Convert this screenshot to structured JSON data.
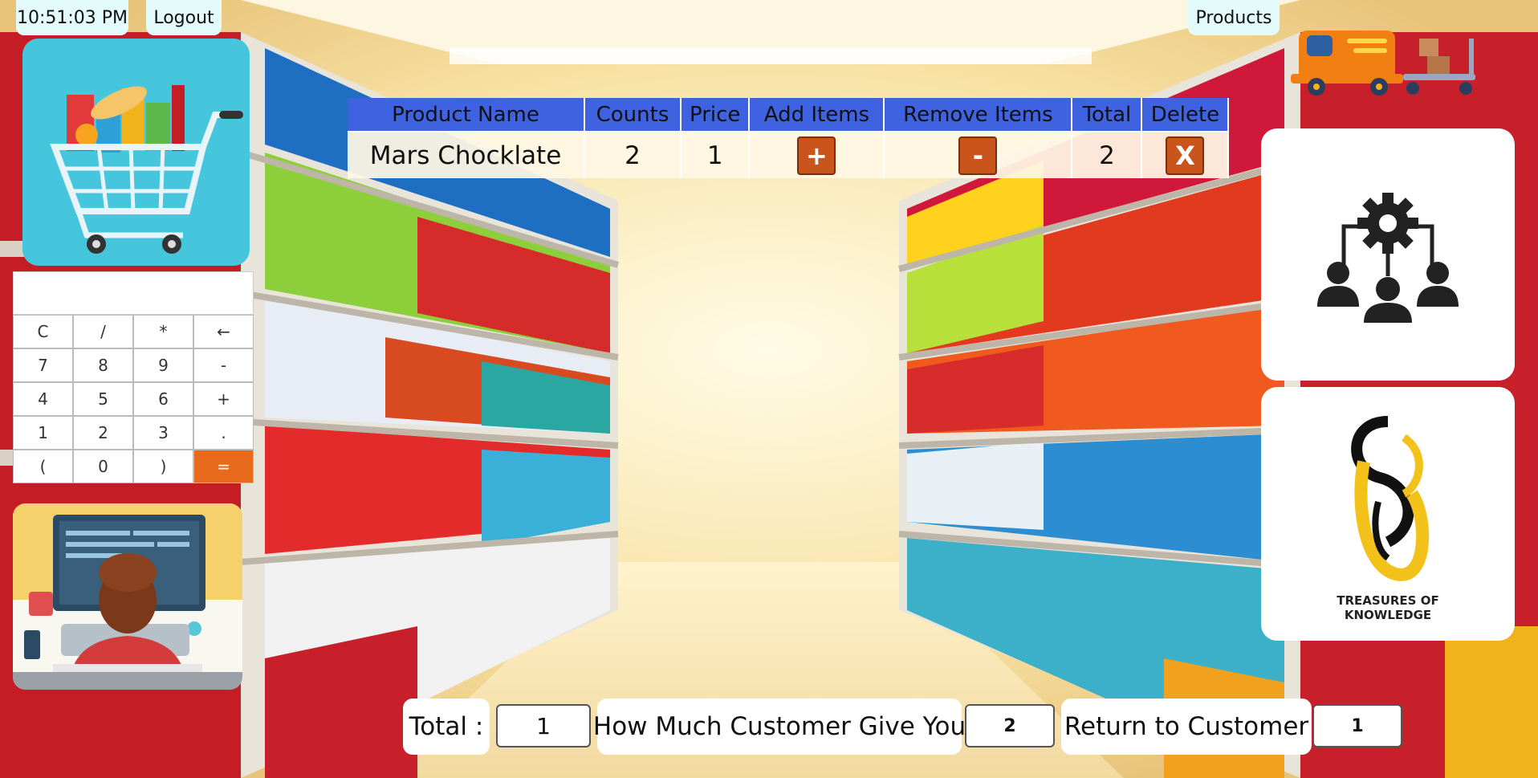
{
  "header": {
    "clock": "10:51:03 PM",
    "logout_label": "Logout",
    "products_label": "Products"
  },
  "table": {
    "columns": [
      "Product Name",
      "Counts",
      "Price",
      "Add Items",
      "Remove Items",
      "Total",
      "Delete"
    ],
    "rows": [
      {
        "name": "Mars Chocklate",
        "count": "2",
        "price": "1",
        "add": "+",
        "remove": "-",
        "total": "2",
        "delete": "X"
      }
    ]
  },
  "calculator": {
    "display": "",
    "keys": [
      "C",
      "/",
      "*",
      "←",
      "7",
      "8",
      "9",
      "-",
      "4",
      "5",
      "6",
      "+",
      "1",
      "2",
      "3",
      ".",
      "(",
      "0",
      ")",
      "="
    ]
  },
  "footer": {
    "total_label": "Total :",
    "total_value": "1",
    "given_label": "How Much Customer Give You",
    "given_value": "2",
    "return_label": "Return to Customer",
    "return_value": "1"
  },
  "logo": {
    "text_line1": "TREASURES OF",
    "text_line2": "KNOWLEDGE"
  },
  "icons": [
    "shopping-cart-icon",
    "delivery-truck-icon",
    "team-settings-icon",
    "treasures-of-knowledge-logo",
    "developer-illustration"
  ],
  "colors": {
    "table_header": "#3f63e0",
    "action_button": "#c9541c",
    "equals_key": "#e86a1c",
    "cart_card": "#45c6dc"
  }
}
